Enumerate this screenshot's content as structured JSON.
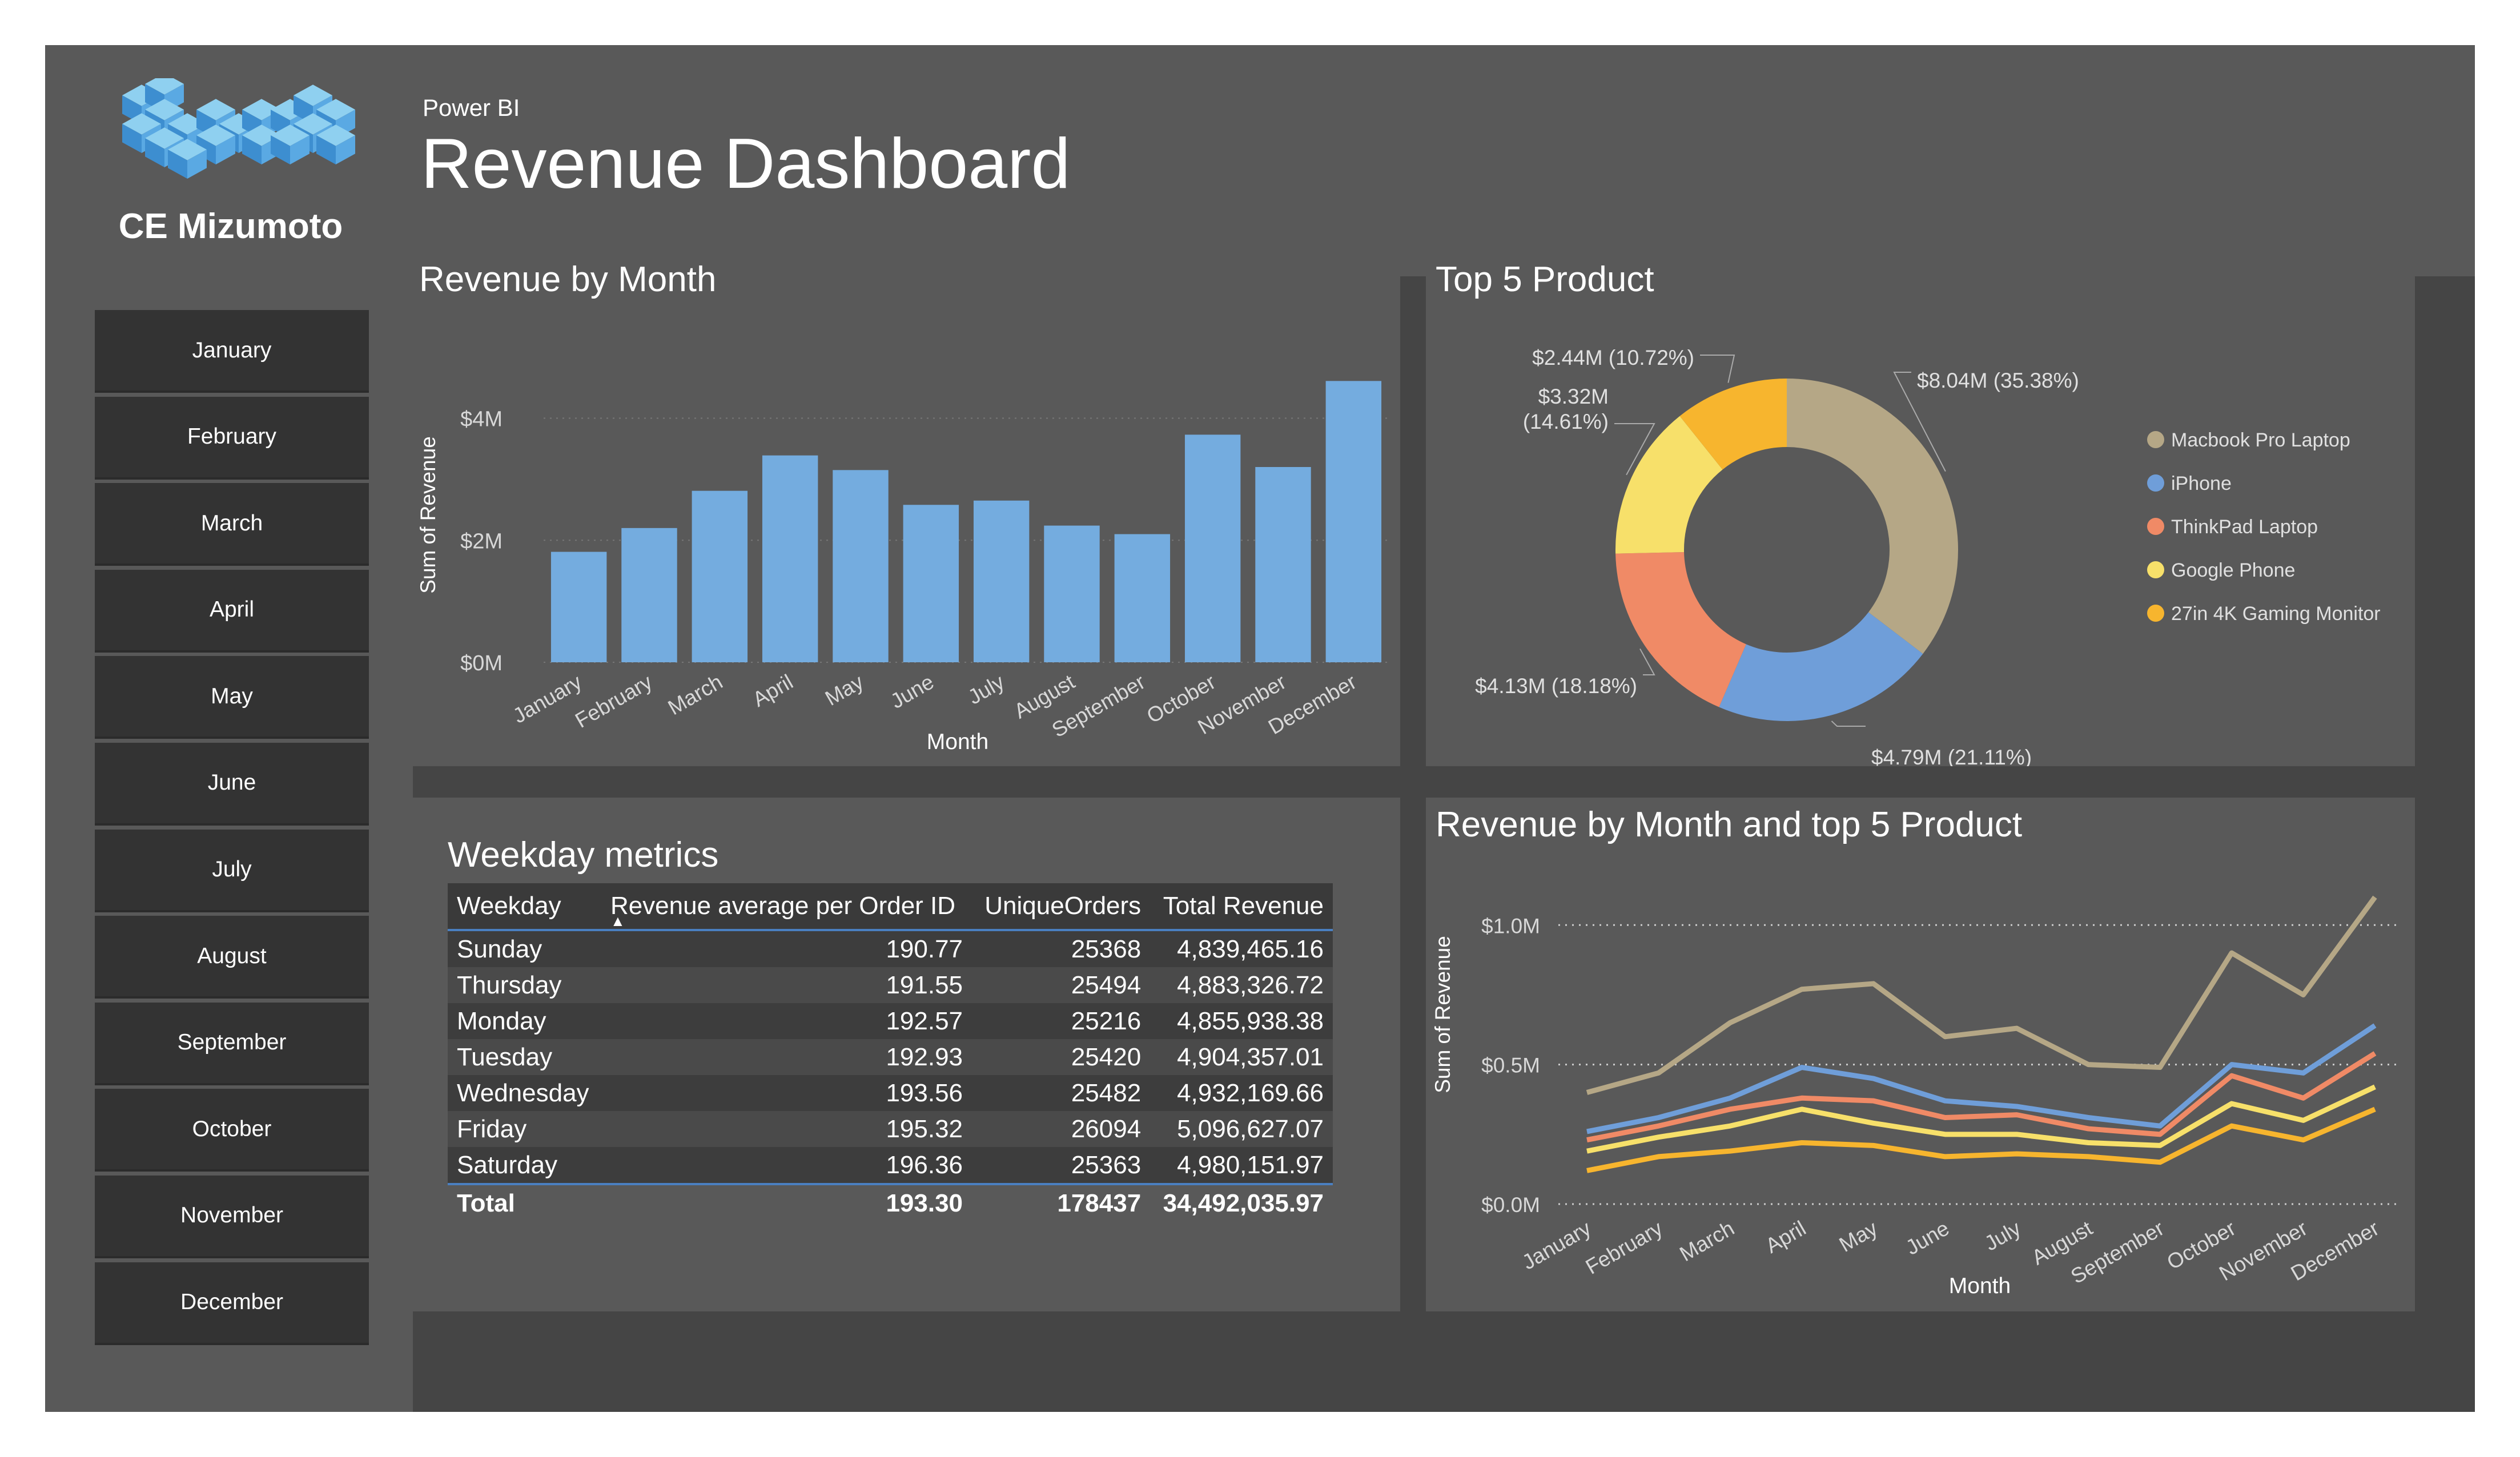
{
  "brand": {
    "name": "CE Mizumoto"
  },
  "header": {
    "app": "Power BI",
    "title": "Revenue Dashboard"
  },
  "months": [
    "January",
    "February",
    "March",
    "April",
    "May",
    "June",
    "July",
    "August",
    "September",
    "October",
    "November",
    "December"
  ],
  "panels": {
    "revenue_by_month": {
      "title": "Revenue by Month"
    },
    "top5": {
      "title": "Top 5 Product"
    },
    "weekday": {
      "title": "Weekday metrics"
    },
    "line": {
      "title": "Revenue by Month and top 5 Product"
    }
  },
  "weekday_table": {
    "headers": [
      "Weekday",
      "Revenue average per Order ID",
      "UniqueOrders",
      "Total Revenue"
    ],
    "rows": [
      [
        "Sunday",
        "190.77",
        "25368",
        "4,839,465.16"
      ],
      [
        "Thursday",
        "191.55",
        "25494",
        "4,883,326.72"
      ],
      [
        "Monday",
        "192.57",
        "25216",
        "4,855,938.38"
      ],
      [
        "Tuesday",
        "192.93",
        "25420",
        "4,904,357.01"
      ],
      [
        "Wednesday",
        "193.56",
        "25482",
        "4,932,169.66"
      ],
      [
        "Friday",
        "195.32",
        "26094",
        "5,096,627.07"
      ],
      [
        "Saturday",
        "196.36",
        "25363",
        "4,980,151.97"
      ]
    ],
    "total": [
      "Total",
      "193.30",
      "178437",
      "34,492,035.97"
    ]
  },
  "chart_data": [
    {
      "type": "bar",
      "title": "Revenue by Month",
      "xlabel": "Month",
      "ylabel": "Sum of Revenue",
      "categories": [
        "January",
        "February",
        "March",
        "April",
        "May",
        "June",
        "July",
        "August",
        "September",
        "October",
        "November",
        "December"
      ],
      "values": [
        1.81,
        2.2,
        2.81,
        3.39,
        3.15,
        2.58,
        2.65,
        2.24,
        2.1,
        3.73,
        3.2,
        4.61
      ],
      "unit": "$M",
      "ylim": [
        0,
        4.8
      ],
      "yticks": [
        "$0M",
        "$2M",
        "$4M"
      ],
      "ytick_values": [
        0,
        2,
        4
      ],
      "color": "#74ACDF",
      "grid": true
    },
    {
      "type": "pie",
      "title": "Top 5 Product",
      "donut": true,
      "slices": [
        {
          "name": "Macbook Pro Laptop",
          "value": 8.04,
          "percent": 35.38,
          "label": "$8.04M (35.38%)",
          "color": "#B5A786"
        },
        {
          "name": "iPhone",
          "value": 4.79,
          "percent": 21.11,
          "label": "$4.79M (21.11%)",
          "color": "#6F9ED9"
        },
        {
          "name": "ThinkPad Laptop",
          "value": 4.13,
          "percent": 18.18,
          "label": "$4.13M (18.18%)",
          "color": "#F08A66"
        },
        {
          "name": "Google Phone",
          "value": 3.32,
          "percent": 14.61,
          "label": "$3.32M (14.61%)",
          "color": "#F7E06A"
        },
        {
          "name": "27in 4K Gaming Monitor",
          "value": 2.44,
          "percent": 10.72,
          "label": "$2.44M (10.72%)",
          "color": "#F7B52E"
        }
      ],
      "legend": "right"
    },
    {
      "type": "line",
      "title": "Revenue by Month and top 5 Product",
      "xlabel": "Month",
      "ylabel": "Sum of Revenue",
      "categories": [
        "January",
        "February",
        "March",
        "April",
        "May",
        "June",
        "July",
        "August",
        "September",
        "October",
        "November",
        "December"
      ],
      "yticks": [
        "$0.0M",
        "$0.5M",
        "$1.0M"
      ],
      "ytick_values": [
        0,
        0.5,
        1.0
      ],
      "ylim": [
        0,
        1.15
      ],
      "series": [
        {
          "name": "Macbook Pro Laptop",
          "color": "#B5A786",
          "values": [
            0.4,
            0.47,
            0.65,
            0.77,
            0.79,
            0.6,
            0.63,
            0.5,
            0.49,
            0.9,
            0.75,
            1.1
          ]
        },
        {
          "name": "iPhone",
          "color": "#6F9ED9",
          "values": [
            0.26,
            0.31,
            0.38,
            0.49,
            0.45,
            0.37,
            0.35,
            0.31,
            0.28,
            0.5,
            0.47,
            0.64
          ]
        },
        {
          "name": "ThinkPad Laptop",
          "color": "#F08A66",
          "values": [
            0.23,
            0.28,
            0.34,
            0.38,
            0.37,
            0.31,
            0.32,
            0.27,
            0.25,
            0.46,
            0.38,
            0.54
          ]
        },
        {
          "name": "Google Phone",
          "color": "#F7E06A",
          "values": [
            0.19,
            0.24,
            0.28,
            0.34,
            0.29,
            0.25,
            0.25,
            0.22,
            0.21,
            0.36,
            0.3,
            0.42
          ]
        },
        {
          "name": "27in 4K Gaming Monitor",
          "color": "#F7B52E",
          "values": [
            0.12,
            0.17,
            0.19,
            0.22,
            0.21,
            0.17,
            0.18,
            0.17,
            0.15,
            0.28,
            0.23,
            0.34
          ]
        }
      ]
    }
  ]
}
